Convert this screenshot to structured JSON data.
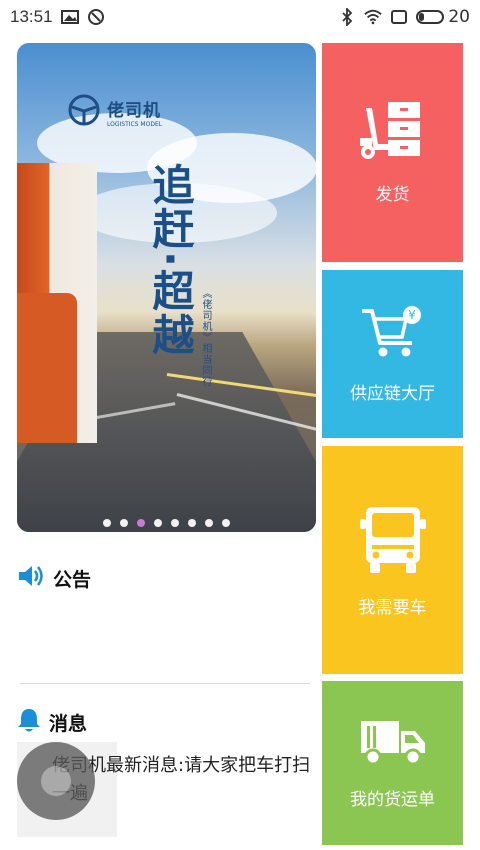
{
  "status_bar": {
    "time": "13:51",
    "battery_level": "20",
    "left_icons": [
      "image-icon",
      "circle-slash-icon"
    ],
    "right_icons": [
      "bluetooth-icon",
      "wifi-icon",
      "screen-icon",
      "battery-icon"
    ]
  },
  "banner": {
    "logo_text": "佬司机",
    "logo_subtext": "LOGISTICS MODEL",
    "slogan": "追赶·超越",
    "slogan_sub": "《佬司机》相当同行",
    "dot_count": 8,
    "active_dot": 2
  },
  "tiles": [
    {
      "label": "发货",
      "icon": "forklift-icon",
      "color": "#f56160"
    },
    {
      "label": "供应链大厅",
      "icon": "shopping-cart-icon",
      "color": "#33b7e3"
    },
    {
      "label": "我需要车",
      "icon": "bus-icon",
      "color": "#f9c51e"
    },
    {
      "label": "我的货运单",
      "icon": "delivery-truck-icon",
      "color": "#8bc652"
    }
  ],
  "notice": {
    "title": "公告",
    "icon": "speaker-icon"
  },
  "message": {
    "title": "消息",
    "icon": "bell-icon",
    "text": "佬司机最新消息:请大家把车打扫一遍"
  },
  "colors": {
    "accent": "#1a8fd8",
    "active_dot": "#c57cd6"
  }
}
